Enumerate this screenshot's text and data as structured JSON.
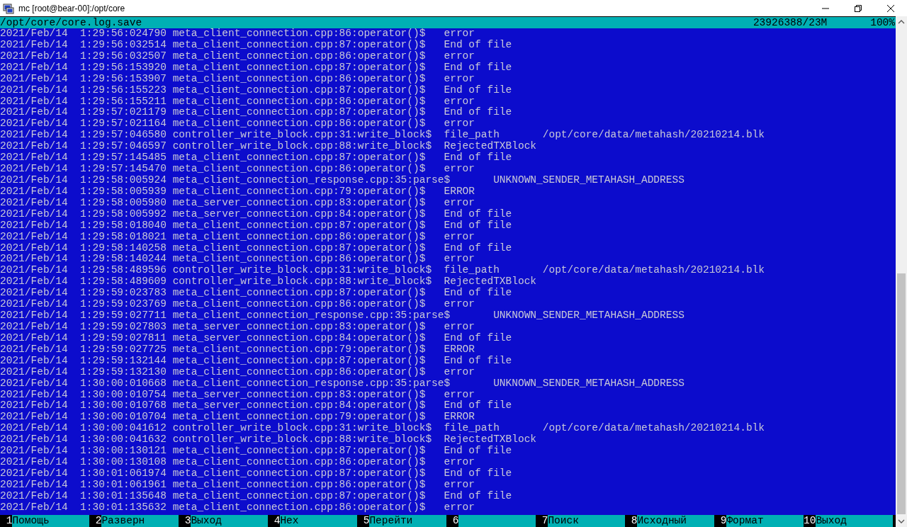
{
  "window": {
    "title": "mc [root@bear-00]:/opt/core"
  },
  "viewer_header": {
    "file": "/opt/core/core.log.save",
    "size": "23926388/23M",
    "percent": "100%"
  },
  "log_lines": [
    {
      "timestamp": "2021/Feb/14  1:29:56:024790",
      "source": "meta_client_connection.cpp:86:operator()$",
      "message": "error"
    },
    {
      "timestamp": "2021/Feb/14  1:29:56:032514",
      "source": "meta_client_connection.cpp:87:operator()$",
      "message": "End of file"
    },
    {
      "timestamp": "2021/Feb/14  1:29:56:032507",
      "source": "meta_client_connection.cpp:86:operator()$",
      "message": "error"
    },
    {
      "timestamp": "2021/Feb/14  1:29:56:153920",
      "source": "meta_client_connection.cpp:87:operator()$",
      "message": "End of file"
    },
    {
      "timestamp": "2021/Feb/14  1:29:56:153907",
      "source": "meta_client_connection.cpp:86:operator()$",
      "message": "error"
    },
    {
      "timestamp": "2021/Feb/14  1:29:56:155223",
      "source": "meta_client_connection.cpp:87:operator()$",
      "message": "End of file"
    },
    {
      "timestamp": "2021/Feb/14  1:29:56:155211",
      "source": "meta_client_connection.cpp:86:operator()$",
      "message": "error"
    },
    {
      "timestamp": "2021/Feb/14  1:29:57:021179",
      "source": "meta_client_connection.cpp:87:operator()$",
      "message": "End of file"
    },
    {
      "timestamp": "2021/Feb/14  1:29:57:021164",
      "source": "meta_client_connection.cpp:86:operator()$",
      "message": "error"
    },
    {
      "timestamp": "2021/Feb/14  1:29:57:046580",
      "source": "controller_write_block.cpp:31:write_block$",
      "message": "file_path",
      "value": "/opt/core/data/metahash/20210214.blk"
    },
    {
      "timestamp": "2021/Feb/14  1:29:57:046597",
      "source": "controller_write_block.cpp:88:write_block$",
      "message": "RejectedTXBlock"
    },
    {
      "timestamp": "2021/Feb/14  1:29:57:145485",
      "source": "meta_client_connection.cpp:87:operator()$",
      "message": "End of file"
    },
    {
      "timestamp": "2021/Feb/14  1:29:57:145470",
      "source": "meta_client_connection.cpp:86:operator()$",
      "message": "error"
    },
    {
      "timestamp": "2021/Feb/14  1:29:58:005924",
      "source": "meta_client_connection_response.cpp:35:parse$",
      "message": "UNKNOWN_SENDER_METAHASH_ADDRESS"
    },
    {
      "timestamp": "2021/Feb/14  1:29:58:005939",
      "source": "meta_client_connection.cpp:79:operator()$",
      "message": "ERROR"
    },
    {
      "timestamp": "2021/Feb/14  1:29:58:005980",
      "source": "meta_server_connection.cpp:83:operator()$",
      "message": "error"
    },
    {
      "timestamp": "2021/Feb/14  1:29:58:005992",
      "source": "meta_server_connection.cpp:84:operator()$",
      "message": "End of file"
    },
    {
      "timestamp": "2021/Feb/14  1:29:58:018040",
      "source": "meta_client_connection.cpp:87:operator()$",
      "message": "End of file"
    },
    {
      "timestamp": "2021/Feb/14  1:29:58:018021",
      "source": "meta_client_connection.cpp:86:operator()$",
      "message": "error"
    },
    {
      "timestamp": "2021/Feb/14  1:29:58:140258",
      "source": "meta_client_connection.cpp:87:operator()$",
      "message": "End of file"
    },
    {
      "timestamp": "2021/Feb/14  1:29:58:140244",
      "source": "meta_client_connection.cpp:86:operator()$",
      "message": "error"
    },
    {
      "timestamp": "2021/Feb/14  1:29:58:489596",
      "source": "controller_write_block.cpp:31:write_block$",
      "message": "file_path",
      "value": "/opt/core/data/metahash/20210214.blk"
    },
    {
      "timestamp": "2021/Feb/14  1:29:58:489609",
      "source": "controller_write_block.cpp:88:write_block$",
      "message": "RejectedTXBlock"
    },
    {
      "timestamp": "2021/Feb/14  1:29:59:023783",
      "source": "meta_client_connection.cpp:87:operator()$",
      "message": "End of file"
    },
    {
      "timestamp": "2021/Feb/14  1:29:59:023769",
      "source": "meta_client_connection.cpp:86:operator()$",
      "message": "error"
    },
    {
      "timestamp": "2021/Feb/14  1:29:59:027711",
      "source": "meta_client_connection_response.cpp:35:parse$",
      "message": "UNKNOWN_SENDER_METAHASH_ADDRESS"
    },
    {
      "timestamp": "2021/Feb/14  1:29:59:027803",
      "source": "meta_server_connection.cpp:83:operator()$",
      "message": "error"
    },
    {
      "timestamp": "2021/Feb/14  1:29:59:027811",
      "source": "meta_server_connection.cpp:84:operator()$",
      "message": "End of file"
    },
    {
      "timestamp": "2021/Feb/14  1:29:59:027725",
      "source": "meta_client_connection.cpp:79:operator()$",
      "message": "ERROR"
    },
    {
      "timestamp": "2021/Feb/14  1:29:59:132144",
      "source": "meta_client_connection.cpp:87:operator()$",
      "message": "End of file"
    },
    {
      "timestamp": "2021/Feb/14  1:29:59:132130",
      "source": "meta_client_connection.cpp:86:operator()$",
      "message": "error"
    },
    {
      "timestamp": "2021/Feb/14  1:30:00:010668",
      "source": "meta_client_connection_response.cpp:35:parse$",
      "message": "UNKNOWN_SENDER_METAHASH_ADDRESS"
    },
    {
      "timestamp": "2021/Feb/14  1:30:00:010754",
      "source": "meta_server_connection.cpp:83:operator()$",
      "message": "error"
    },
    {
      "timestamp": "2021/Feb/14  1:30:00:010768",
      "source": "meta_server_connection.cpp:84:operator()$",
      "message": "End of file"
    },
    {
      "timestamp": "2021/Feb/14  1:30:00:010704",
      "source": "meta_client_connection.cpp:79:operator()$",
      "message": "ERROR"
    },
    {
      "timestamp": "2021/Feb/14  1:30:00:041612",
      "source": "controller_write_block.cpp:31:write_block$",
      "message": "file_path",
      "value": "/opt/core/data/metahash/20210214.blk"
    },
    {
      "timestamp": "2021/Feb/14  1:30:00:041632",
      "source": "controller_write_block.cpp:88:write_block$",
      "message": "RejectedTXBlock"
    },
    {
      "timestamp": "2021/Feb/14  1:30:00:130121",
      "source": "meta_client_connection.cpp:87:operator()$",
      "message": "End of file"
    },
    {
      "timestamp": "2021/Feb/14  1:30:00:130108",
      "source": "meta_client_connection.cpp:86:operator()$",
      "message": "error"
    },
    {
      "timestamp": "2021/Feb/14  1:30:01:061974",
      "source": "meta_client_connection.cpp:87:operator()$",
      "message": "End of file"
    },
    {
      "timestamp": "2021/Feb/14  1:30:01:061961",
      "source": "meta_client_connection.cpp:86:operator()$",
      "message": "error"
    },
    {
      "timestamp": "2021/Feb/14  1:30:01:135648",
      "source": "meta_client_connection.cpp:87:operator()$",
      "message": "End of file"
    },
    {
      "timestamp": "2021/Feb/14  1:30:01:135632",
      "source": "meta_client_connection.cpp:86:operator()$",
      "message": "error"
    }
  ],
  "function_keys": [
    {
      "number": "1",
      "label": "Помощь"
    },
    {
      "number": "2",
      "label": "Разверн"
    },
    {
      "number": "3",
      "label": "Выход"
    },
    {
      "number": "4",
      "label": "Hex"
    },
    {
      "number": "5",
      "label": "Перейти"
    },
    {
      "number": "6"
    },
    {
      "number": "7",
      "label": "Поиск"
    },
    {
      "number": "8",
      "label": "Исходный"
    },
    {
      "number": "9",
      "label": "Формат"
    },
    {
      "number": "10",
      "label": "Выход"
    }
  ]
}
